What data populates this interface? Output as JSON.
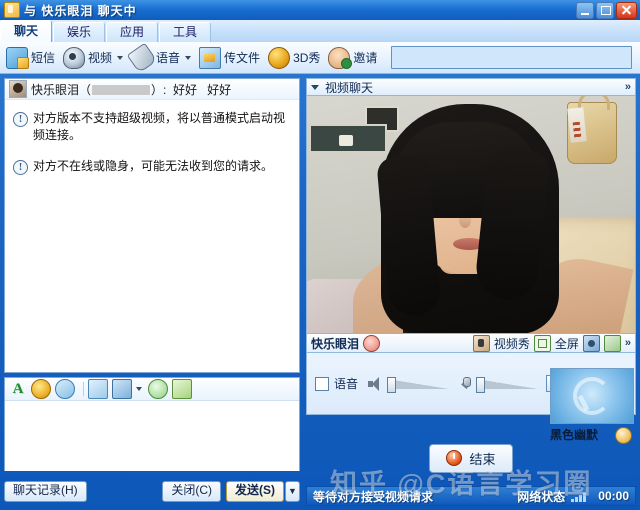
{
  "window": {
    "title": "与 快乐眼泪 聊天中",
    "icon": "chat-window-icon",
    "buttons": {
      "minimize": "minimize-icon",
      "maximize": "maximize-icon",
      "close": "close-icon"
    }
  },
  "tabs": [
    {
      "label": "聊天",
      "active": true
    },
    {
      "label": "娱乐",
      "active": false
    },
    {
      "label": "应用",
      "active": false
    },
    {
      "label": "工具",
      "active": false
    }
  ],
  "toolbar": {
    "items": [
      {
        "label": "短信",
        "icon": "sms-icon",
        "caret": false
      },
      {
        "label": "视频",
        "icon": "video-camera-icon",
        "caret": true
      },
      {
        "label": "语音",
        "icon": "microphone-icon",
        "caret": true
      },
      {
        "label": "传文件",
        "icon": "send-file-icon",
        "caret": false
      },
      {
        "label": "3D秀",
        "icon": "3d-show-icon",
        "caret": false
      },
      {
        "label": "邀请",
        "icon": "invite-icon",
        "caret": false
      }
    ],
    "search_value": ""
  },
  "chat": {
    "header": {
      "nickname": "快乐眼泪",
      "account_masked": true,
      "suffix": "）:",
      "message_a": "好好",
      "message_b": "好好"
    },
    "messages": [
      {
        "icon": "info-icon",
        "text": "对方版本不支持超级视频，将以普通模式启动视频连接。"
      },
      {
        "icon": "info-icon",
        "text": "对方不在线或隐身，可能无法收到您的请求。"
      }
    ],
    "input_tools": [
      {
        "icon": "font-icon",
        "label": "A"
      },
      {
        "icon": "emoticon-icon",
        "label": ""
      },
      {
        "icon": "magic-expression-icon",
        "label": ""
      },
      {
        "icon": "image-icon",
        "label": ""
      },
      {
        "icon": "screen-capture-icon",
        "label": ""
      },
      {
        "icon": "shake-window-icon",
        "label": ""
      },
      {
        "icon": "gift-icon",
        "label": ""
      }
    ],
    "input_value": "",
    "input_placeholder": "",
    "buttons": {
      "history": "聊天记录(H)",
      "close": "关闭(C)",
      "send": "发送(S)",
      "send_dropdown": "▼"
    }
  },
  "video_panel": {
    "header_title": "视频聊天",
    "collapse_icon": "triangle-down-icon",
    "expand_icon": "chevron-right-icon",
    "expand_label": "»",
    "controls": {
      "peer_name": "快乐眼泪",
      "mask_icon": "video-mask-icon",
      "video_show_icon": "video-show-icon",
      "video_show_label": "视频秀",
      "fullscreen_icon": "fullscreen-icon",
      "fullscreen_label": "全屏",
      "snapshot_icon": "camera-snapshot-icon",
      "swap_icon": "swap-view-icon",
      "more_label": "»"
    },
    "audio": {
      "checkbox_label": "语音",
      "checkbox_checked": false,
      "speaker_icon": "speaker-icon",
      "mic_icon": "microphone-icon",
      "speaker_level": 0,
      "mic_level": 0,
      "more_label": "»"
    },
    "end_button": {
      "label": "结束",
      "icon": "power-off-icon"
    },
    "self_thumbnail": {
      "label": "黑色幽默",
      "badge_icon": "emoticon-badge-icon"
    }
  },
  "status_bar": {
    "left_text": "等待对方接受视频请求",
    "network_label": "网络状态",
    "signal_icon": "signal-bars-icon",
    "timer": "00:00"
  },
  "watermark": {
    "text": "知乎 @C语言学习圈"
  },
  "colors": {
    "title_accent": "#1a6fd0",
    "status_bar": "#0f59bb",
    "panel_border": "#8fb8df",
    "close_button": "#d4341a"
  }
}
